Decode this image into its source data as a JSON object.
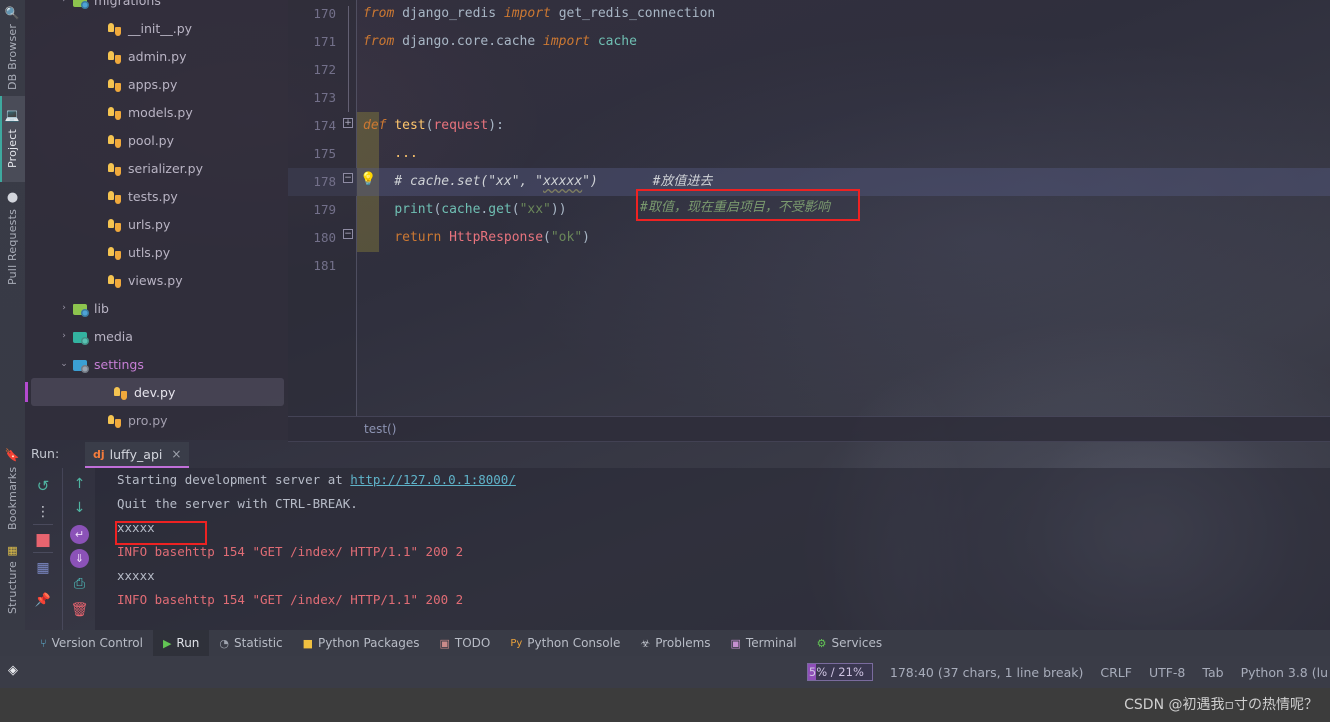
{
  "toolstrip": {
    "items": [
      {
        "label": "DB Browser",
        "icon": "db-browser-icon",
        "selected": false
      },
      {
        "label": "Project",
        "icon": "project-icon",
        "selected": true
      },
      {
        "label": "Pull Requests",
        "icon": "github-icon",
        "selected": false
      },
      {
        "label": "Bookmarks",
        "icon": "bookmarks-icon",
        "selected": false
      },
      {
        "label": "Structure",
        "icon": "structure-icon",
        "selected": false
      }
    ]
  },
  "project_tree": {
    "items": [
      {
        "label": "migrations",
        "icon": "folder-green",
        "arrow": "›",
        "indent": 46,
        "type": "folder",
        "selected": false,
        "clipped": true
      },
      {
        "label": "__init__.py",
        "icon": "python-file",
        "arrow": "",
        "indent": 80,
        "type": "file",
        "selected": false
      },
      {
        "label": "admin.py",
        "icon": "python-file",
        "arrow": "",
        "indent": 80,
        "type": "file",
        "selected": false
      },
      {
        "label": "apps.py",
        "icon": "python-file",
        "arrow": "",
        "indent": 80,
        "type": "file",
        "selected": false
      },
      {
        "label": "models.py",
        "icon": "python-file",
        "arrow": "",
        "indent": 80,
        "type": "file",
        "selected": false
      },
      {
        "label": "pool.py",
        "icon": "python-file",
        "arrow": "",
        "indent": 80,
        "type": "file",
        "selected": false
      },
      {
        "label": "serializer.py",
        "icon": "python-file",
        "arrow": "",
        "indent": 80,
        "type": "file",
        "selected": false
      },
      {
        "label": "tests.py",
        "icon": "python-file",
        "arrow": "",
        "indent": 80,
        "type": "file",
        "selected": false
      },
      {
        "label": "urls.py",
        "icon": "python-file",
        "arrow": "",
        "indent": 80,
        "type": "file",
        "selected": false
      },
      {
        "label": "utls.py",
        "icon": "python-file",
        "arrow": "",
        "indent": 80,
        "type": "file",
        "selected": false
      },
      {
        "label": "views.py",
        "icon": "python-file",
        "arrow": "",
        "indent": 80,
        "type": "file",
        "selected": false
      },
      {
        "label": "lib",
        "icon": "folder-green",
        "arrow": "›",
        "indent": 46,
        "type": "folder",
        "selected": false
      },
      {
        "label": "media",
        "icon": "folder-teal",
        "arrow": "›",
        "indent": 46,
        "type": "folder",
        "selected": false
      },
      {
        "label": "settings",
        "icon": "folder-blue",
        "arrow": "⌄",
        "indent": 46,
        "type": "folder",
        "selected": false,
        "accent": true
      },
      {
        "label": "dev.py",
        "icon": "python-file",
        "arrow": "",
        "indent": 80,
        "type": "file",
        "selected": true
      },
      {
        "label": "pro.py",
        "icon": "python-file",
        "arrow": "",
        "indent": 80,
        "type": "file",
        "selected": false,
        "dim": true
      }
    ]
  },
  "editor": {
    "lines": [
      {
        "num": "170",
        "tokens": [
          {
            "t": "from",
            "c": "kw-it"
          },
          {
            "t": " ",
            "c": "plain"
          },
          {
            "t": "django_redis",
            "c": "plain"
          },
          {
            "t": " ",
            "c": "plain"
          },
          {
            "t": "import",
            "c": "kw-it"
          },
          {
            "t": " ",
            "c": "plain"
          },
          {
            "t": "get_redis_connection",
            "c": "plain"
          }
        ]
      },
      {
        "num": "171",
        "tokens": [
          {
            "t": "from",
            "c": "kw-it"
          },
          {
            "t": " ",
            "c": "plain"
          },
          {
            "t": "django.core.cache",
            "c": "plain"
          },
          {
            "t": " ",
            "c": "plain"
          },
          {
            "t": "import",
            "c": "kw-it"
          },
          {
            "t": " ",
            "c": "plain"
          },
          {
            "t": "cache",
            "c": "imp"
          }
        ]
      },
      {
        "num": "172",
        "tokens": []
      },
      {
        "num": "173",
        "tokens": []
      },
      {
        "num": "174",
        "tokens": [
          {
            "t": "def",
            "c": "kw-it"
          },
          {
            "t": " ",
            "c": "plain"
          },
          {
            "t": "test",
            "c": "fn"
          },
          {
            "t": "(",
            "c": "punc"
          },
          {
            "t": "request",
            "c": "cls"
          },
          {
            "t": "):",
            "c": "punc"
          }
        ]
      },
      {
        "num": "175",
        "tokens": [
          {
            "t": "    ...",
            "c": "fn"
          }
        ]
      },
      {
        "num": "178",
        "tokens": [
          {
            "t": "    # cache.set(\"xx\", \"",
            "c": "cmt"
          },
          {
            "t": "xxxxx",
            "c": "cmt sqwig"
          },
          {
            "t": "\")       #放值进去",
            "c": "cmt"
          }
        ]
      },
      {
        "num": "179",
        "tokens": [
          {
            "t": "    ",
            "c": "plain"
          },
          {
            "t": "print",
            "c": "imp"
          },
          {
            "t": "(",
            "c": "punc"
          },
          {
            "t": "cache",
            "c": "imp"
          },
          {
            "t": ".",
            "c": "punc"
          },
          {
            "t": "get",
            "c": "imp"
          },
          {
            "t": "(",
            "c": "punc"
          },
          {
            "t": "\"xx\"",
            "c": "str"
          },
          {
            "t": "))",
            "c": "punc"
          }
        ]
      },
      {
        "num": "180",
        "tokens": [
          {
            "t": "    ",
            "c": "plain"
          },
          {
            "t": "return",
            "c": "kw"
          },
          {
            "t": " ",
            "c": "plain"
          },
          {
            "t": "HttpResponse",
            "c": "cls"
          },
          {
            "t": "(",
            "c": "punc"
          },
          {
            "t": "\"ok\"",
            "c": "str"
          },
          {
            "t": ")",
            "c": "punc"
          }
        ]
      },
      {
        "num": "181",
        "tokens": []
      }
    ],
    "inline_annotation": "#取值，现在重启项目，不受影响",
    "current_line_index": 6,
    "breadcrumb": "test()"
  },
  "run_panel": {
    "run_label": "Run:",
    "tab_name": "luffy_api",
    "tab_icon": "django-icon",
    "tab_close": "×",
    "left_buttons": [
      {
        "name": "rerun-icon",
        "glyph": "↺",
        "color": "#4fb3a0"
      },
      {
        "name": "more-options-icon",
        "glyph": "⋮",
        "color": "#c5c8d0"
      },
      {
        "name": "stop-icon",
        "glyph": "■",
        "color": "#e8646f"
      },
      {
        "name": "layout-icon",
        "glyph": "⌸",
        "color": "#7b88c4"
      },
      {
        "name": "pin-icon",
        "glyph": "📌",
        "color": "#b48fd8"
      }
    ],
    "right_buttons": [
      {
        "name": "scroll-up-icon",
        "glyph": "↑",
        "color": "#4fb3a0"
      },
      {
        "name": "scroll-down-icon",
        "glyph": "↓",
        "color": "#4fb3a0"
      },
      {
        "name": "soft-wrap-icon",
        "glyph": "↵",
        "color": "#b06ed0"
      },
      {
        "name": "scroll-to-end-icon",
        "glyph": "↡",
        "color": "#b06ed0"
      },
      {
        "name": "print-icon",
        "glyph": "⎙",
        "color": "#4fc3c0"
      },
      {
        "name": "clear-all-icon",
        "glyph": "🗑",
        "color": "#e8646f"
      }
    ],
    "console_lines": [
      {
        "segments": [
          {
            "t": "Starting development server at ",
            "c": "c-white"
          },
          {
            "t": "http://127.0.0.1:8000/",
            "c": "c-link"
          }
        ]
      },
      {
        "segments": [
          {
            "t": "Quit the server with CTRL-BREAK.",
            "c": "c-white"
          }
        ]
      },
      {
        "segments": [
          {
            "t": "xxxxx",
            "c": "c-white"
          }
        ],
        "boxed": true
      },
      {
        "segments": [
          {
            "t": "INFO basehttp 154 \"GET /index/ HTTP/1.1\" 200 2",
            "c": "c-red"
          }
        ]
      },
      {
        "segments": [
          {
            "t": "xxxxx",
            "c": "c-white"
          }
        ]
      },
      {
        "segments": [
          {
            "t": "INFO basehttp 154 \"GET /index/ HTTP/1.1\" 200 2",
            "c": "c-red"
          }
        ]
      }
    ]
  },
  "bottom_tabs": [
    {
      "label": "Version Control",
      "icon": "branch-icon",
      "glyph": "⑂",
      "color": "#5fb3d4",
      "active": false
    },
    {
      "label": "Run",
      "icon": "run-icon",
      "glyph": "▶",
      "color": "#62c554",
      "active": true
    },
    {
      "label": "Statistic",
      "icon": "statistic-icon",
      "glyph": "◔",
      "color": "#9fa4af",
      "active": false
    },
    {
      "label": "Python Packages",
      "icon": "package-icon",
      "glyph": "■",
      "color": "#f0c040",
      "active": false
    },
    {
      "label": "TODO",
      "icon": "todo-icon",
      "glyph": "▣",
      "color": "#c98a8a",
      "active": false
    },
    {
      "label": "Python Console",
      "icon": "python-console-icon",
      "glyph": "Py",
      "color": "#e8a13c",
      "active": false
    },
    {
      "label": "Problems",
      "icon": "problems-icon",
      "glyph": "☣",
      "color": "#c0c4cc",
      "active": false
    },
    {
      "label": "Terminal",
      "icon": "terminal-icon",
      "glyph": "▣",
      "color": "#c48fd0",
      "active": false
    },
    {
      "label": "Services",
      "icon": "services-icon",
      "glyph": "⚙",
      "color": "#62c554",
      "active": false
    }
  ],
  "status_bar": {
    "left_icon": "layers-icon",
    "memory": "5% / 21%",
    "memory_fill_percent": 13,
    "caret": "178:40 (37 chars, 1 line break)",
    "line_separator": "CRLF",
    "encoding": "UTF-8",
    "indent": "Tab",
    "interpreter": "Python 3.8 (lu"
  },
  "watermark": "CSDN @初遇我▫寸の热情呢？",
  "colors": {
    "annotation_red": "#ee2222",
    "accent_purple": "#c06fd8",
    "selection_blue": "#565a82",
    "panel_bg": "#393b46"
  }
}
